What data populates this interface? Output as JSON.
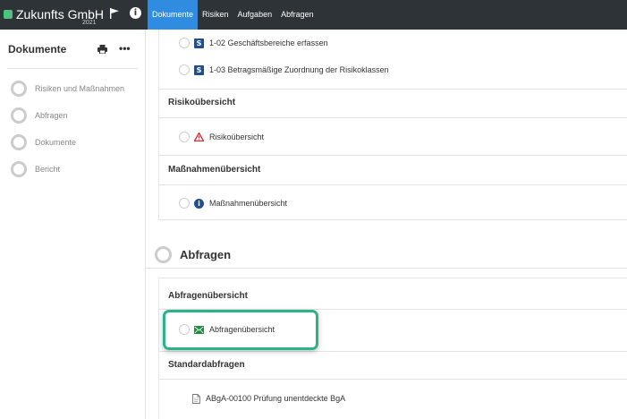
{
  "app": {
    "company": "Zukunfts GmbH",
    "year": "2021",
    "brand_color": "#4cc27d"
  },
  "nav": {
    "items": [
      {
        "label": "Dokumente",
        "active": true
      },
      {
        "label": "Risiken",
        "active": false
      },
      {
        "label": "Aufgaben",
        "active": false
      },
      {
        "label": "Abfragen",
        "active": false
      }
    ],
    "active_color": "#2f8ce0"
  },
  "sidebar": {
    "title": "Dokumente",
    "more": "•••",
    "items": [
      {
        "label": "Risiken und Maßnahmen"
      },
      {
        "label": "Abfragen"
      },
      {
        "label": "Dokumente"
      },
      {
        "label": "Bericht"
      }
    ]
  },
  "main": {
    "top_items": [
      {
        "icon": "s-icon",
        "icon_text": "S",
        "label": "1-02 Geschäftsbereiche erfassen"
      },
      {
        "icon": "s-icon",
        "icon_text": "S",
        "label": "1-03 Betragsmäßige Zuordnung der Risikoklassen"
      }
    ],
    "risk_overview": {
      "header": "Risikoübersicht",
      "item": {
        "icon": "warning-icon",
        "label": "Risikoübersicht"
      }
    },
    "measures_overview": {
      "header": "Maßnahmenübersicht",
      "item": {
        "icon": "info-icon",
        "icon_text": "i",
        "label": "Maßnahmenübersicht"
      }
    },
    "queries_section": {
      "title": "Abfragen",
      "overview_header": "Abfragenübersicht",
      "overview_item": {
        "icon": "mail-icon",
        "label": "Abfragenübersicht"
      },
      "standard_header": "Standardabfragen",
      "standard_items": [
        {
          "icon": "document-icon",
          "label": "ABgA-00100 Prüfung unentdeckte BgA"
        }
      ]
    },
    "highlight_color": "#2bb48a"
  }
}
